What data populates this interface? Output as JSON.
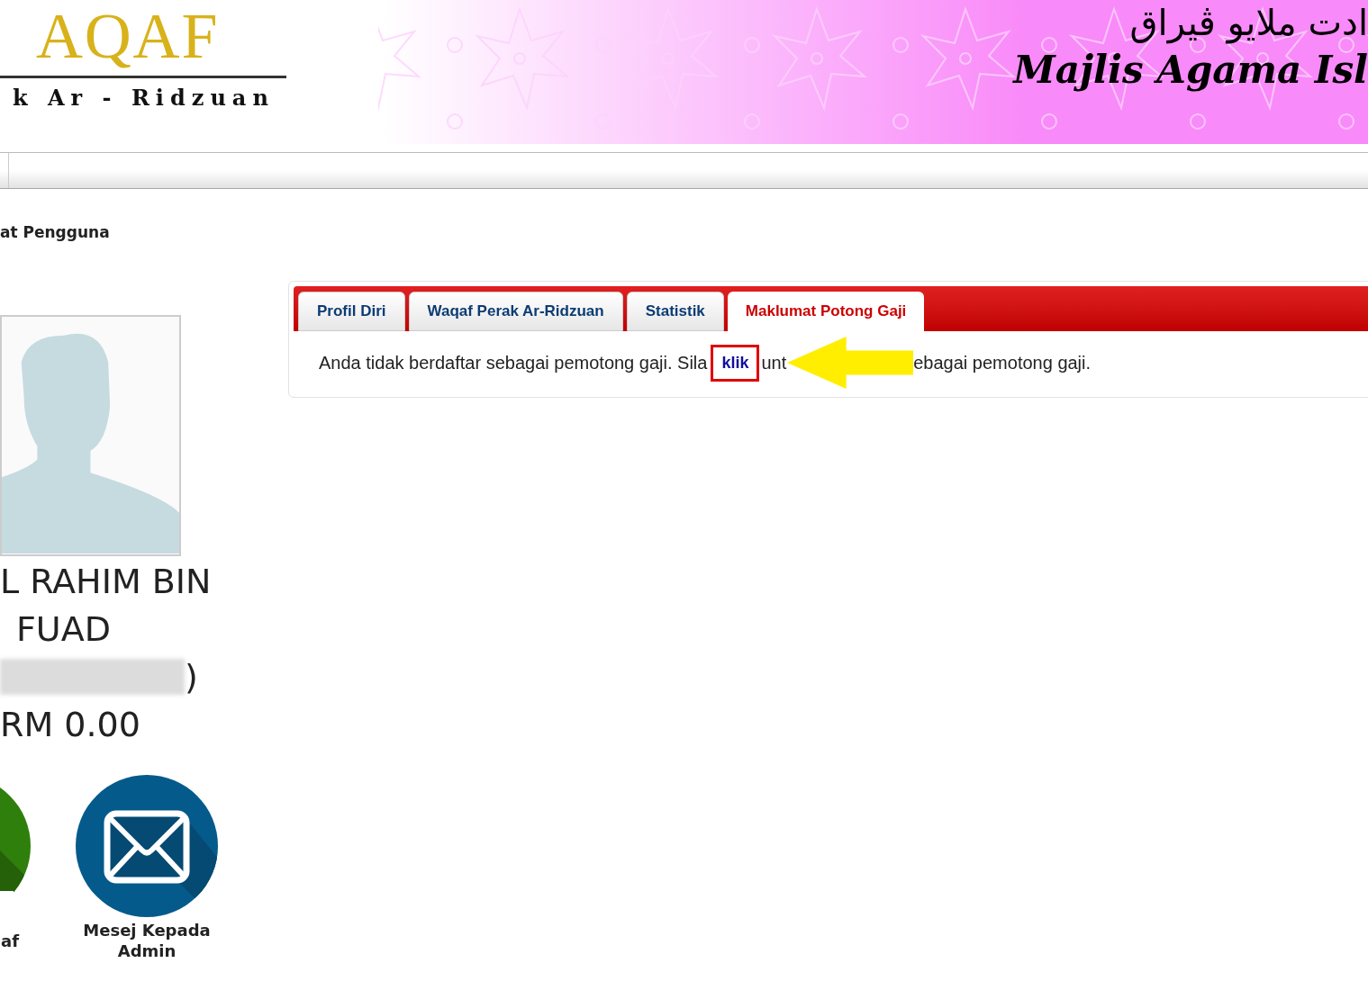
{
  "header": {
    "logo_text": "AQAF",
    "logo_subtitle": "k Ar - Ridzuan",
    "jawi_title": "ادت ملايو ڤيراق",
    "title": "Majlis Agama Isl"
  },
  "section_title": "at Pengguna",
  "profile": {
    "name_lines": [
      "L RAHIM BIN",
      "FUAD"
    ],
    "id_suffix": ")",
    "balance": "RM 0.00"
  },
  "shortcuts": [
    {
      "kind": "waqaf",
      "label": "af"
    },
    {
      "kind": "mail",
      "label": "Mesej Kepada Admin"
    }
  ],
  "tabs": [
    {
      "label": "Profil Diri",
      "selected": false
    },
    {
      "label": "Waqaf Perak Ar-Ridzuan",
      "selected": false
    },
    {
      "label": "Statistik",
      "selected": false
    },
    {
      "label": "Maklumat Potong Gaji",
      "selected": true
    }
  ],
  "message": {
    "before": "Anda tidak berdaftar sebagai pemotong gaji. Sila",
    "link": "klik",
    "after_link": "unt",
    "end": "ebagai pemotong gaji."
  }
}
